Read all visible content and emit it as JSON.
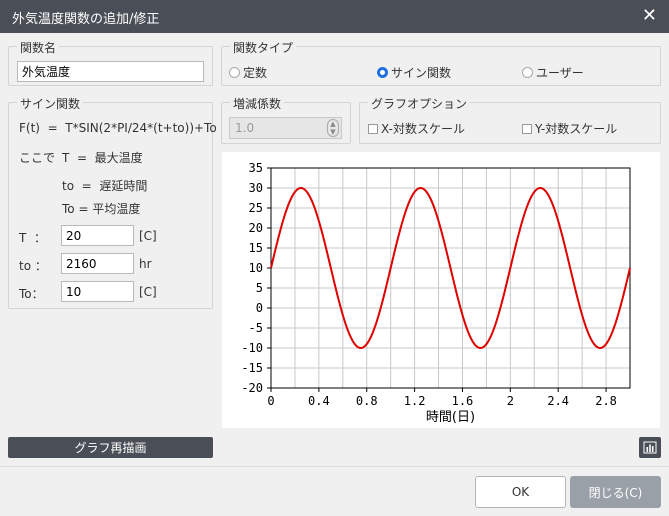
{
  "window": {
    "title": "外気温度関数の追加/修正"
  },
  "name_group": {
    "legend": "関数名",
    "value": "外気温度"
  },
  "type_group": {
    "legend": "関数タイプ",
    "options": [
      "定数",
      "サイン関数",
      "ユーザー"
    ],
    "selected": "サイン関数"
  },
  "sine_group": {
    "legend": "サイン関数",
    "formula": "F(t)  =  T*SIN(2*PI/24*(t+to))+To",
    "where": "ここで",
    "def_T": "T  =  最大温度",
    "def_to": "to  =  遅延時間",
    "def_To": "To = 平均温度",
    "T_label": "T  ：",
    "T_value": "20",
    "T_unit": "[C]",
    "to_label": "to ：",
    "to_value": "2160",
    "to_unit": "hr",
    "To_label": "To：",
    "To_value": "10",
    "To_unit": "[C]"
  },
  "factor_group": {
    "legend": "増減係数",
    "value": "1.0"
  },
  "graph_options": {
    "legend": "グラフオプション",
    "x_log": "X-対数スケール",
    "y_log": "Y-対数スケール"
  },
  "redraw_label": "グラフ再描画",
  "chart_icon": "bar-chart-icon",
  "footer": {
    "ok": "OK",
    "close": "閉じる(C)"
  },
  "chart_data": {
    "type": "line",
    "xlabel": "時間(日)",
    "ylabel": "",
    "xlim": [
      0,
      3
    ],
    "ylim": [
      -20,
      35
    ],
    "xticks": [
      "0",
      "0.4",
      "0.8",
      "1.2",
      "1.6",
      "2",
      "2.4",
      "2.8"
    ],
    "yticks": [
      "35",
      "30",
      "25",
      "20",
      "15",
      "10",
      "5",
      "0",
      "-5",
      "-10",
      "-15",
      "-20"
    ],
    "grid": true,
    "series": [
      {
        "color": "#e00000",
        "x": [
          0,
          0.125,
          0.25,
          0.375,
          0.5,
          0.625,
          0.75,
          0.875,
          1.0,
          1.125,
          1.25,
          1.375,
          1.5,
          1.625,
          1.75,
          1.875,
          2.0,
          2.125,
          2.25,
          2.375,
          2.5,
          2.625,
          2.75,
          2.875,
          3.0
        ],
        "y": [
          10,
          24.14,
          30,
          24.14,
          10,
          -4.14,
          -10,
          -4.14,
          10,
          24.14,
          30,
          24.14,
          10,
          -4.14,
          -10,
          -4.14,
          10,
          24.14,
          30,
          24.14,
          10,
          -4.14,
          -10,
          -4.14,
          10
        ]
      }
    ]
  }
}
